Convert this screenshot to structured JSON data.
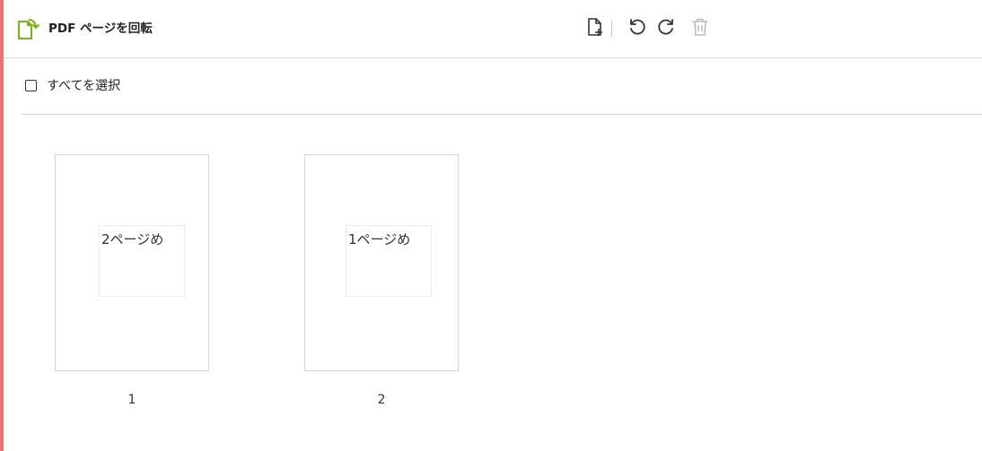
{
  "header": {
    "title": "PDF ページを回転",
    "icon": "rotate-pdf-icon",
    "accent_color": "#7ab317",
    "toolbar": [
      {
        "name": "add-page-button",
        "icon": "file-plus-icon",
        "enabled": true
      },
      {
        "name": "rotate-left-button",
        "icon": "rotate-ccw-icon",
        "enabled": true
      },
      {
        "name": "rotate-right-button",
        "icon": "rotate-cw-icon",
        "enabled": true
      },
      {
        "name": "delete-button",
        "icon": "trash-icon",
        "enabled": false
      }
    ]
  },
  "selection": {
    "select_all_label": "すべてを選択",
    "checked": false
  },
  "pages": [
    {
      "content": "2ページめ",
      "number": "1"
    },
    {
      "content": "1ページめ",
      "number": "2"
    }
  ],
  "colors": {
    "left_border": "#f07078",
    "icon_enabled": "#333333",
    "icon_disabled": "#bbbbbb"
  }
}
